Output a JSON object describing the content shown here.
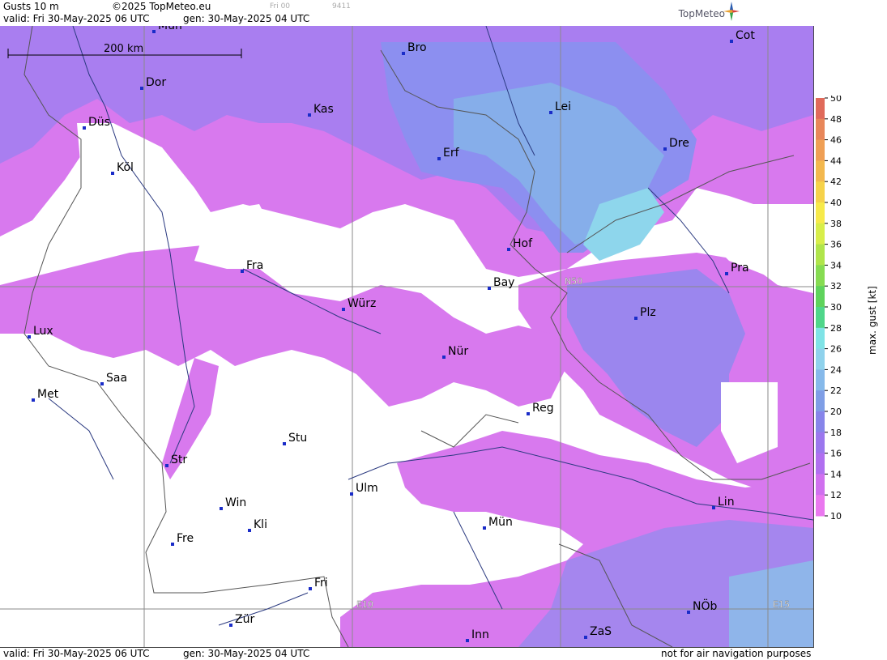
{
  "header": {
    "param": "Gusts 10 m",
    "copyright": "©2025 TopMeteo.eu",
    "run_tag": "Fri 00",
    "code": "9411",
    "valid": "valid:  Fri  30-May-2025  06 UTC",
    "gen": "gen: 30-May-2025 04 UTC",
    "brand": "TopMeteo"
  },
  "footer": {
    "valid": "valid:  Fri  30-May-2025  06 UTC",
    "gen": "gen: 30-May-2025 04 UTC",
    "note": "not for air navigation purposes"
  },
  "scale_bar": {
    "label": "200 km"
  },
  "grid_labels": {
    "lat": "N50",
    "lon1": "E10",
    "lon2": "E15"
  },
  "cities": [
    {
      "name": "Mün",
      "short": "Mün_top"
    },
    {
      "name": "Bro"
    },
    {
      "name": "Cot"
    },
    {
      "name": "Dor"
    },
    {
      "name": "Kas"
    },
    {
      "name": "Lei"
    },
    {
      "name": "Düs"
    },
    {
      "name": "Erf"
    },
    {
      "name": "Dre"
    },
    {
      "name": "Köl"
    },
    {
      "name": "Hof"
    },
    {
      "name": "Fra"
    },
    {
      "name": "Pra"
    },
    {
      "name": "Bay"
    },
    {
      "name": "Würz"
    },
    {
      "name": "Plz"
    },
    {
      "name": "Lux"
    },
    {
      "name": "Nür"
    },
    {
      "name": "Saa"
    },
    {
      "name": "Met"
    },
    {
      "name": "Reg"
    },
    {
      "name": "Stu"
    },
    {
      "name": "Str"
    },
    {
      "name": "Ulm"
    },
    {
      "name": "Win"
    },
    {
      "name": "Lin"
    },
    {
      "name": "Kli"
    },
    {
      "name": "Mün"
    },
    {
      "name": "Fre"
    },
    {
      "name": "Fri"
    },
    {
      "name": "NÖb"
    },
    {
      "name": "Zür"
    },
    {
      "name": "Inn"
    },
    {
      "name": "ZaS"
    }
  ],
  "legend": {
    "title": "max. gust [kt]",
    "ticks": [
      "50",
      "48",
      "46",
      "44",
      "42",
      "40",
      "38",
      "36",
      "34",
      "32",
      "30",
      "28",
      "26",
      "24",
      "22",
      "20",
      "18",
      "16",
      "14",
      "12",
      "10"
    ],
    "colors": [
      "#e06a5a",
      "#e8875a",
      "#ef9f55",
      "#f3b84e",
      "#f6d24a",
      "#f7ea4a",
      "#d8ee4a",
      "#b0e54b",
      "#86dc52",
      "#5fd35c",
      "#4fd68a",
      "#7fe3e6",
      "#8fd2ec",
      "#86b9ea",
      "#7f9ee6",
      "#8785ea",
      "#9b77ee",
      "#b06ff0",
      "#d070ef",
      "#ea78ef"
    ]
  }
}
